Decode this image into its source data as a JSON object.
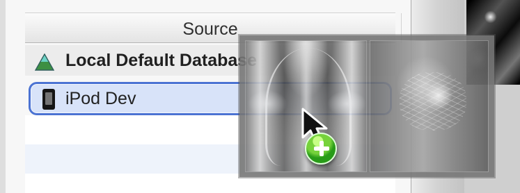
{
  "source": {
    "header": "Source",
    "group": {
      "label": "Local Default Database",
      "icon": "database-icon"
    },
    "device": {
      "label": "iPod Dev",
      "icon": "ipod-icon"
    }
  },
  "drag_preview": {
    "items": [
      {
        "name": "chest-xray-thumbnail"
      },
      {
        "name": "lung-scan-thumbnail"
      }
    ],
    "badge_icon": "plus-icon"
  },
  "colors": {
    "selection_border": "#4b73d3",
    "selection_fill": "#d8e3f9",
    "add_badge": "#289b18"
  }
}
